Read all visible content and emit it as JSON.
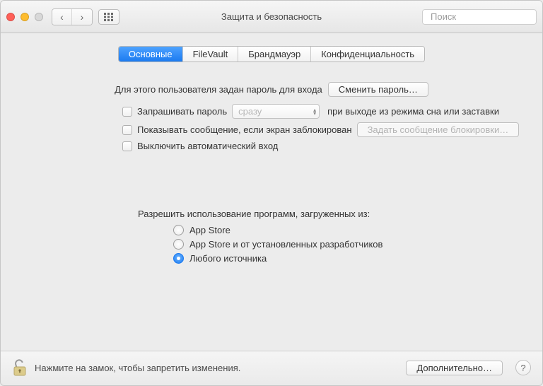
{
  "window": {
    "title": "Защита и безопасность",
    "search_placeholder": "Поиск"
  },
  "tabs": [
    {
      "label": "Основные",
      "selected": true
    },
    {
      "label": "FileVault",
      "selected": false
    },
    {
      "label": "Брандмауэр",
      "selected": false
    },
    {
      "label": "Конфиденциальность",
      "selected": false
    }
  ],
  "general": {
    "password_set_text": "Для этого пользователя задан пароль для входа",
    "change_password_btn": "Сменить пароль…",
    "require_password_label": "Запрашивать пароль",
    "require_password_delay": "сразу",
    "require_password_suffix": "при выходе из режима сна или заставки",
    "show_message_label": "Показывать сообщение, если экран заблокирован",
    "set_lock_message_btn": "Задать сообщение блокировки…",
    "disable_autologin_label": "Выключить автоматический вход"
  },
  "downloads": {
    "title": "Разрешить использование программ, загруженных из:",
    "options": [
      {
        "label": "App Store",
        "selected": false
      },
      {
        "label": "App Store и от установленных разработчиков",
        "selected": false
      },
      {
        "label": "Любого источника",
        "selected": true
      }
    ]
  },
  "footer": {
    "lock_hint": "Нажмите на замок, чтобы запретить изменения.",
    "advanced_btn": "Дополнительно…"
  }
}
